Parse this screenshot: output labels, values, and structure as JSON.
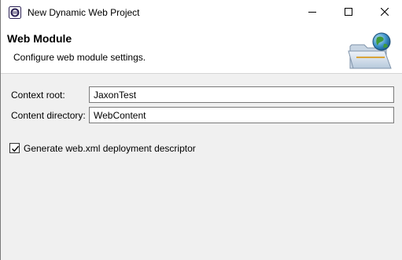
{
  "window": {
    "title": "New Dynamic Web Project"
  },
  "header": {
    "title": "Web Module",
    "description": "Configure web module settings."
  },
  "form": {
    "context_root": {
      "label": "Context root:",
      "value": "JaxonTest"
    },
    "content_directory": {
      "label": "Content directory:",
      "value": "WebContent"
    },
    "generate_descriptor": {
      "label": "Generate web.xml deployment descriptor",
      "checked": true
    }
  },
  "icons": {
    "app": "eclipse-icon",
    "minimize": "minimize-icon",
    "maximize": "maximize-icon",
    "close": "close-icon",
    "wizard": "web-folder-globe-icon",
    "check": "checkmark-icon"
  },
  "colors": {
    "window_bg": "#f0f0f0",
    "header_bg": "#ffffff",
    "input_border": "#7a7a7a"
  }
}
